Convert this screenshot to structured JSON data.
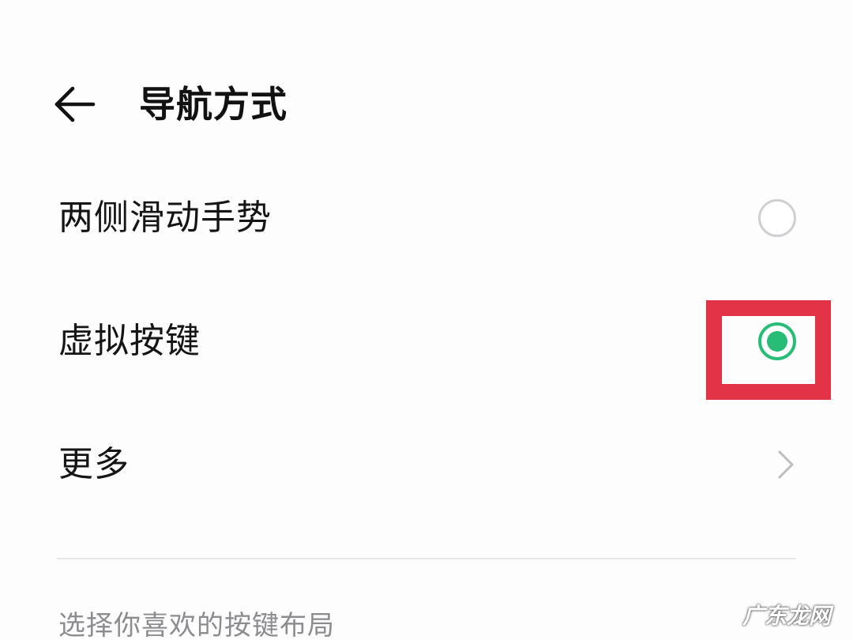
{
  "header": {
    "back_icon": "arrow-left-icon",
    "title": "导航方式"
  },
  "options": [
    {
      "label": "两侧滑动手势",
      "control": "radio",
      "selected": false
    },
    {
      "label": "虚拟按键",
      "control": "radio",
      "selected": true
    },
    {
      "label": "更多",
      "control": "chevron",
      "icon": "chevron-right-icon"
    }
  ],
  "section": {
    "header": "选择你喜欢的按键布局"
  },
  "watermark": "广东龙网",
  "colors": {
    "accent": "#27bd77",
    "highlight": "#e23346",
    "radio_off": "#cfcfd3",
    "text_primary": "#151515",
    "text_secondary": "#8c8c90"
  }
}
